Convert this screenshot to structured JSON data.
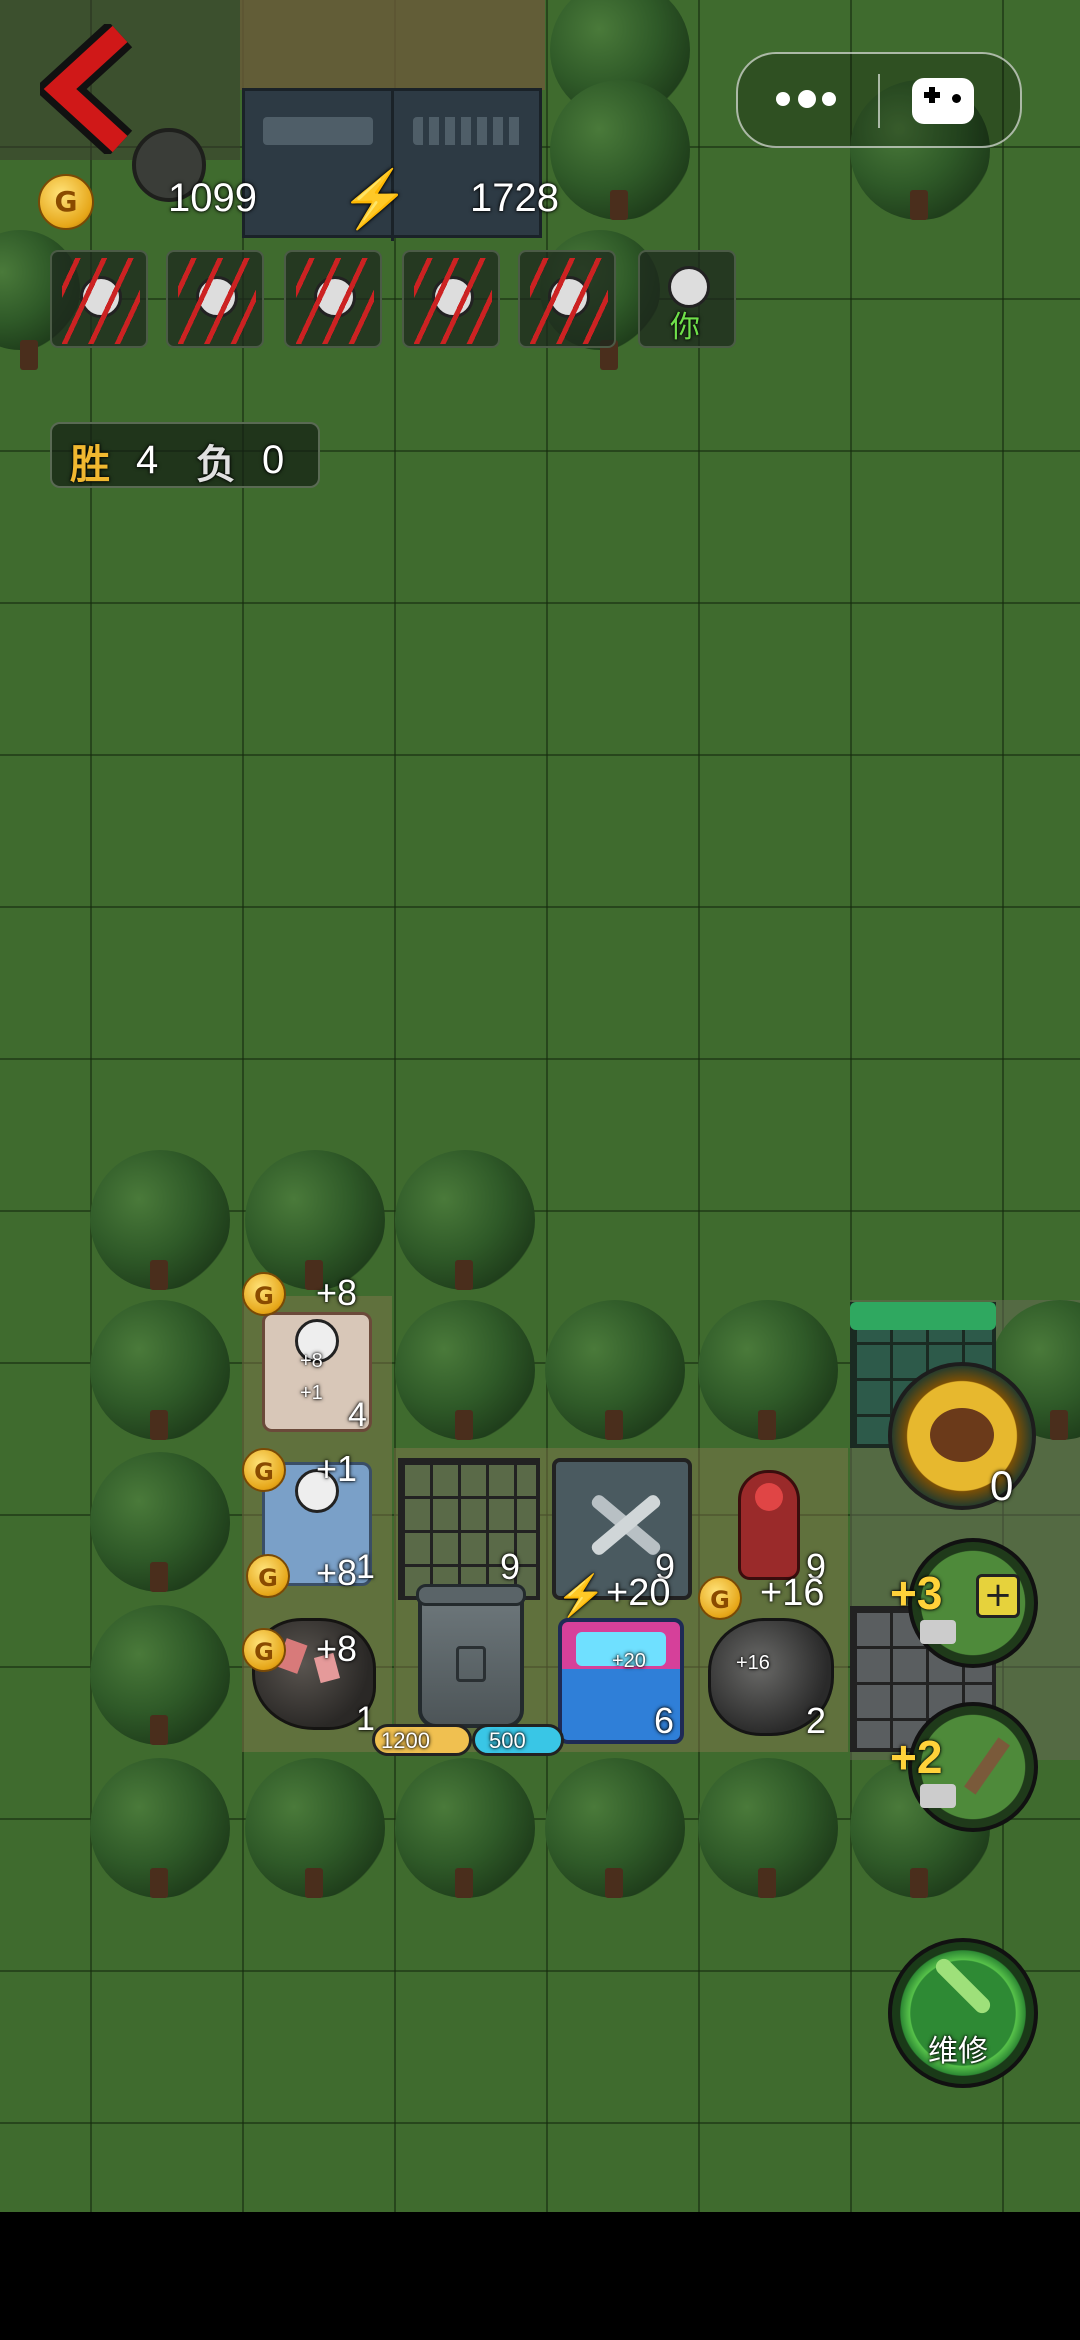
{
  "hud": {
    "coins": "1099",
    "energy": "1728",
    "coin_symbol": "G"
  },
  "score": {
    "win_label": "胜",
    "win_count": "4",
    "loss_label": "负",
    "loss_count": "0"
  },
  "opponents": {
    "self_label": "你"
  },
  "board": {
    "bed1": {
      "income": "+8",
      "sub1": "+8",
      "sub2": "+1",
      "level": "4"
    },
    "bed2": {
      "income_top": "+1",
      "income_bottom": "+8",
      "level": "1"
    },
    "ore1": {
      "income": "+8",
      "level": "1"
    },
    "door": {
      "level": "9"
    },
    "workbench": {
      "level": "9"
    },
    "generator": {
      "energy": "+20",
      "inner": "+20",
      "level": "6"
    },
    "turret": {
      "level": "9"
    },
    "ore2": {
      "income": "+16",
      "inner": "+16",
      "level": "2"
    },
    "trash": {
      "coin_cost": "1200",
      "energy_cost": "500"
    },
    "boss": {
      "count": "0"
    }
  },
  "actions": {
    "build_bonus": "+3",
    "dig_bonus": "+2",
    "repair_label": "维修"
  },
  "colors": {
    "grass": "#3f6b2e",
    "coin": "#e6a618",
    "energy": "#39c6e6",
    "back_arrow": "#d01818",
    "repair": "#3fa83a"
  }
}
